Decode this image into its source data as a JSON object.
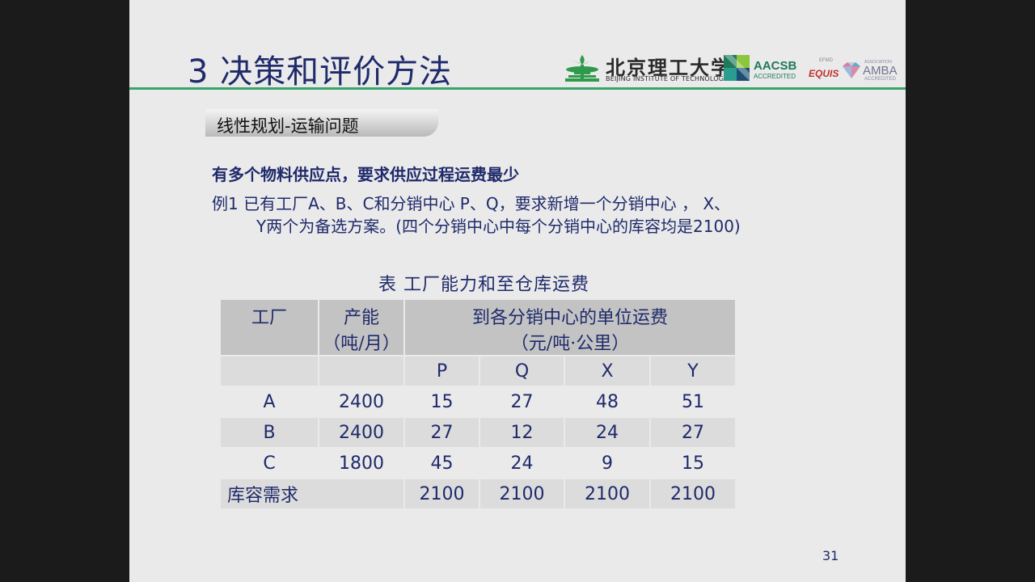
{
  "slide": {
    "title": "3 决策和评价方法",
    "page_number": "31"
  },
  "logos": {
    "bit_chinese": "北京理工大学",
    "bit_english": "BEIJING INSTITUTE OF TECHNOLOGY",
    "aacsb": "AACSB",
    "aacsb_sub": "ACCREDITED",
    "efmd": "EFMD",
    "equis": "EQUIS",
    "amba_top": "ASSOCIATION",
    "amba": "AMBA",
    "amba_sub": "ACCREDITED"
  },
  "section_label": "线性规划-运输问题",
  "content": {
    "heading": "有多个物料供应点，要求供应过程运费最少",
    "example_line1": "例1   已有工厂A、B、C和分销中心 P、Q，要求新增一个分销中心 ， X、",
    "example_line2": "Y两个为备选方案。(四个分销中心中每个分销中心的库容均是2100)"
  },
  "table": {
    "caption": "表   工厂能力和至仓库运费",
    "header": {
      "factory": "工厂",
      "capacity_l1": "产能",
      "capacity_l2": "（吨/月）",
      "cost_l1": "到各分销中心的单位运费",
      "cost_l2": "（元/吨·公里）"
    },
    "subheader": [
      "",
      "",
      "P",
      "Q",
      "X",
      "Y"
    ],
    "rows": [
      [
        "A",
        "2400",
        "15",
        "27",
        "48",
        "51"
      ],
      [
        "B",
        "2400",
        "27",
        "12",
        "24",
        "27"
      ],
      [
        "C",
        "1800",
        "45",
        "24",
        "9",
        "15"
      ]
    ],
    "footer": {
      "label": "库容需求",
      "values": [
        "2100",
        "2100",
        "2100",
        "2100"
      ]
    }
  }
}
